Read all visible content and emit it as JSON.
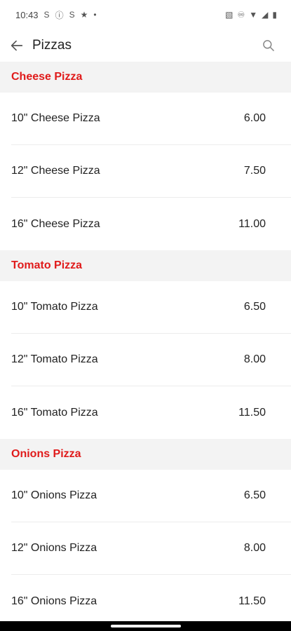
{
  "status_bar": {
    "time": "10:43",
    "left_icons": [
      "S",
      "ⓘ",
      "S",
      "★",
      "•"
    ],
    "right_icons": [
      "▧",
      "♾",
      "▼",
      "◢",
      "▮"
    ]
  },
  "app_bar": {
    "title": "Pizzas",
    "back_icon": "arrow-left-icon",
    "search_icon": "search-icon"
  },
  "sections": [
    {
      "title": "Cheese Pizza",
      "items": [
        {
          "name": "10\" Cheese Pizza",
          "price": "6.00"
        },
        {
          "name": "12\" Cheese Pizza",
          "price": "7.50"
        },
        {
          "name": "16\" Cheese Pizza",
          "price": "11.00"
        }
      ]
    },
    {
      "title": "Tomato Pizza",
      "items": [
        {
          "name": "10\" Tomato Pizza",
          "price": "6.50"
        },
        {
          "name": "12\" Tomato Pizza",
          "price": "8.00"
        },
        {
          "name": "16\" Tomato Pizza",
          "price": "11.50"
        }
      ]
    },
    {
      "title": "Onions Pizza",
      "items": [
        {
          "name": "10\" Onions Pizza",
          "price": "6.50"
        },
        {
          "name": "12\" Onions Pizza",
          "price": "8.00"
        },
        {
          "name": "16\" Onions Pizza",
          "price": "11.50"
        }
      ]
    }
  ],
  "colors": {
    "section_title": "#e01b1b",
    "section_bg": "#f3f3f3",
    "text": "#222222"
  }
}
